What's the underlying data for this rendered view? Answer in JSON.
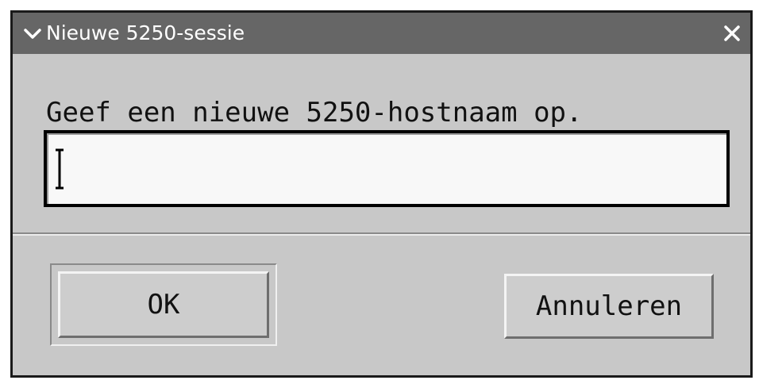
{
  "window": {
    "title": "Nieuwe 5250-sessie"
  },
  "dialog": {
    "prompt": "Geef een nieuwe 5250-hostnaam op.",
    "host_input": {
      "value": "",
      "placeholder": ""
    },
    "ok_label": "OK",
    "cancel_label": "Annuleren"
  },
  "icons": {
    "menu": "chevron-down-icon",
    "close": "close-icon",
    "cursor": "text-cursor-icon"
  },
  "colors": {
    "titlebar_bg": "#666666",
    "titlebar_text": "#ffffff",
    "window_bg": "#c8c8c8",
    "input_bg": "#f8f8f8",
    "frame_border": "#1a1a1a"
  }
}
